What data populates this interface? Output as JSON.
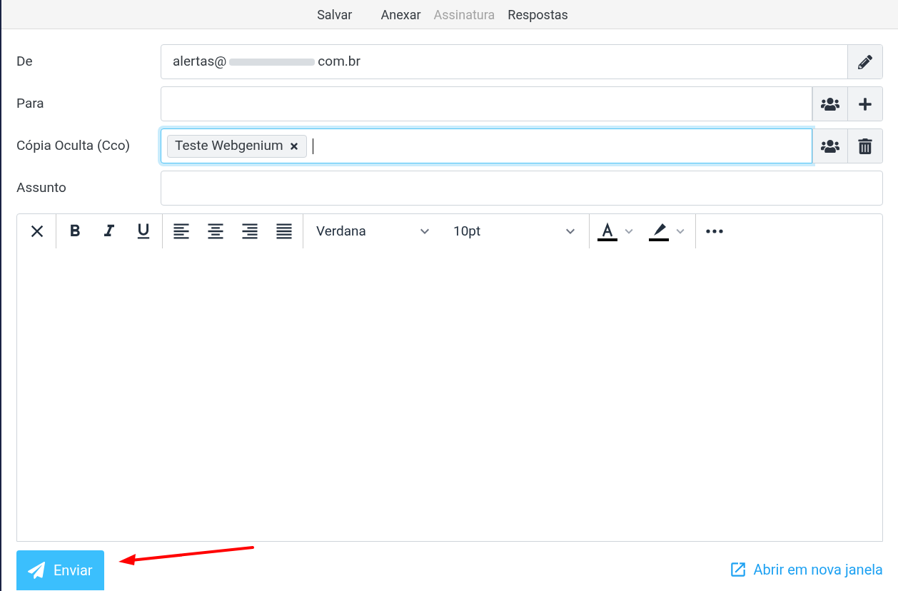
{
  "menu": [
    {
      "label": "Salvar",
      "disabled": false
    },
    {
      "label": "Anexar",
      "disabled": false
    },
    {
      "label": "Assinatura",
      "disabled": true
    },
    {
      "label": "Respostas",
      "disabled": false
    }
  ],
  "fields": [
    {
      "label": "De",
      "kind": "from",
      "value_start": "alertas@",
      "value_end": "com.br",
      "focused": false
    },
    {
      "label": "Para",
      "kind": "recipients",
      "focused": false
    },
    {
      "label": "Cópia Oculta (Cco)",
      "kind": "recipients_bcc",
      "tags": [
        "Teste Webgenium"
      ],
      "focused": true
    },
    {
      "label": "Assunto",
      "kind": "text",
      "focused": false
    }
  ],
  "editor": {
    "font": "Verdana",
    "size": "10pt"
  },
  "send_button": "Enviar",
  "open_window_link": "Abrir em nova janela"
}
